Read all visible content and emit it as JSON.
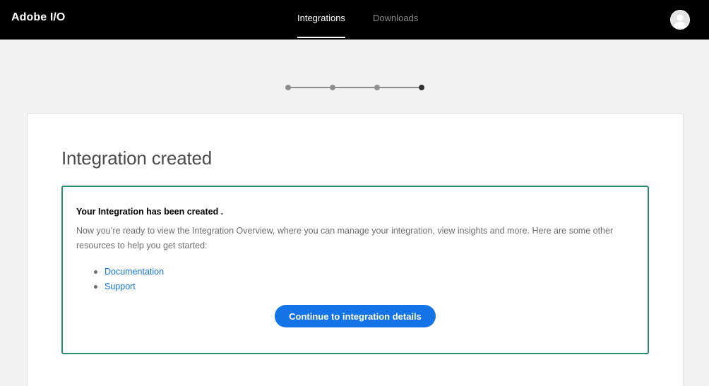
{
  "header": {
    "brand": "Adobe I/O",
    "tabs": [
      {
        "label": "Integrations",
        "active": true
      },
      {
        "label": "Downloads",
        "active": false
      }
    ]
  },
  "stepper": {
    "total_steps": 4,
    "current_step": 4
  },
  "main": {
    "title": "Integration created",
    "success": {
      "heading": "Your Integration has been created .",
      "text": "Now you’re ready to view the Integration Overview, where you can manage your integration, view insights and more. Here are some other resources to help you get started:",
      "links": [
        {
          "label": "Documentation"
        },
        {
          "label": "Support"
        }
      ],
      "button_label": "Continue to integration details"
    }
  },
  "colors": {
    "topbar": "#000000",
    "accent": "#1473e6",
    "success_border": "#268e6c",
    "page_background": "#f2f2f2"
  }
}
